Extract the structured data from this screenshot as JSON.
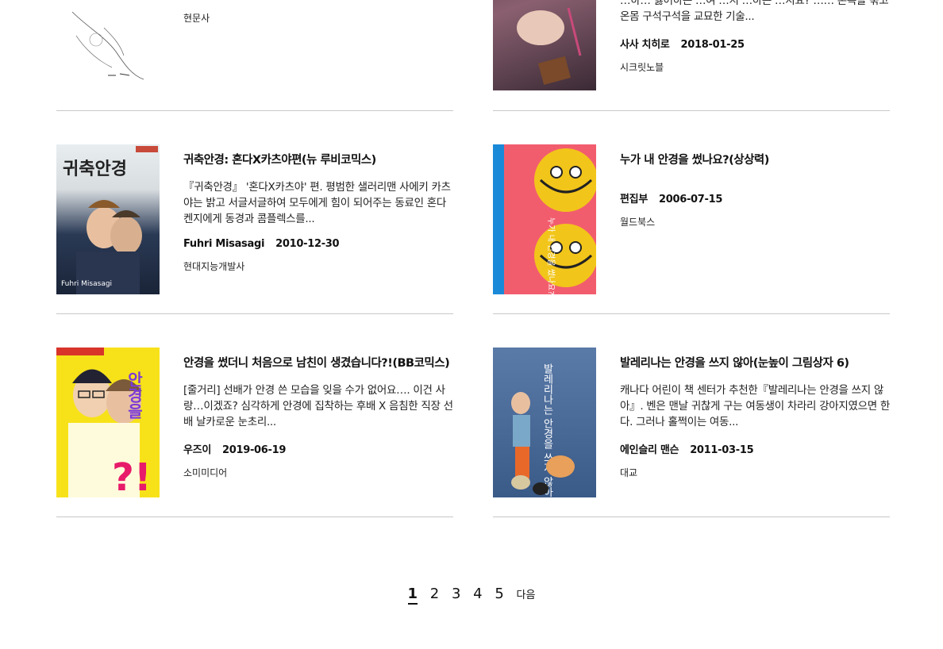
{
  "books": [
    {
      "title": "",
      "desc": "",
      "author": "",
      "date": "",
      "publisher": "현문사"
    },
    {
      "title": "",
      "desc": "…하… 싫어하는 …여 …지 …하는 …지요? …… 손목을 묶고 온몸 구석구석을 교묘한 기술...",
      "author": "사사 치히로",
      "date": "2018-01-25",
      "publisher": "시크릿노블"
    },
    {
      "title": "귀축안경: 혼다X카츠야편(뉴 루비코믹스)",
      "desc": "『귀축안경』 '혼다X카츠야' 편. 평범한 샐러리맨 사에키 카츠야는 밝고 서글서글하여 모두에게 힘이 되어주는 동료인 혼다 켄지에게 동경과 콤플렉스를...",
      "author": "Fuhri Misasagi",
      "date": "2010-12-30",
      "publisher": "현대지능개발사",
      "cover_text": "귀축안경"
    },
    {
      "title": "누가 내 안경을 썼나요?(상상력)",
      "desc": "",
      "author": "편집부",
      "date": "2006-07-15",
      "publisher": "월드북스",
      "cover_text": "누가 내 안경을 썼나요?"
    },
    {
      "title": "안경을 썼더니 처음으로 남친이 생겼습니다?!(BB코믹스)",
      "desc": "[줄거리] 선배가 안경 쓴 모습을 잊을 수가 없어요…. 이건 사랑…이겠죠? 심각하게 안경에 집착하는 후배 X 음침한 직장 선배 날카로운 눈초리...",
      "author": "우즈이",
      "date": "2019-06-19",
      "publisher": "소미미디어",
      "cover_text": "안경을"
    },
    {
      "title": "발레리나는 안경을 쓰지 않아(눈높이 그림상자 6)",
      "desc": "캐나다 어린이 책 센터가 추천한『발레리나는 안경을 쓰지 않아』. 벤은 맨날 귀찮게 구는 여동생이 차라리 강아지였으면 한다. 그러나 홀쩍이는 여동...",
      "author": "에인슬리 맨슨",
      "date": "2011-03-15",
      "publisher": "대교",
      "cover_text": "발레리나는 안경을 쓰지 않아"
    }
  ],
  "pagination": {
    "pages": [
      "1",
      "2",
      "3",
      "4",
      "5"
    ],
    "current": "1",
    "next_label": "다음"
  }
}
